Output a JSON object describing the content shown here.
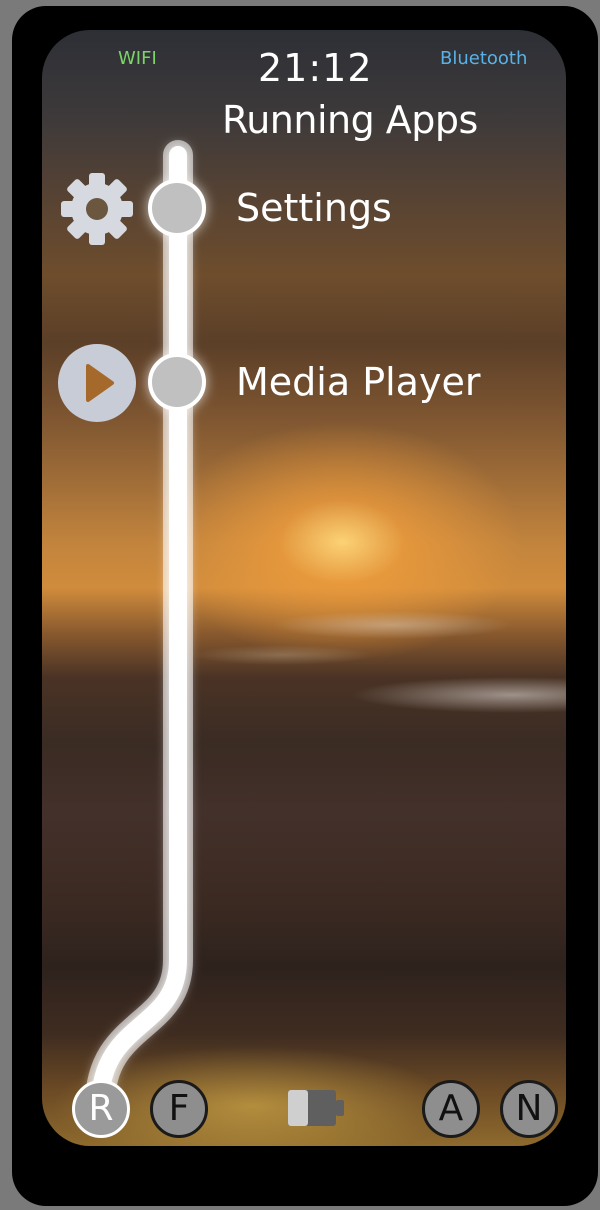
{
  "status_bar": {
    "wifi_label": "WIFI",
    "bluetooth_label": "Bluetooth",
    "time": "21:12",
    "wifi_color": "#7bd468",
    "bluetooth_color": "#58b2e8"
  },
  "heading": "Running Apps",
  "apps": [
    {
      "label": "Settings",
      "icon": "gear-icon"
    },
    {
      "label": "Media Player",
      "icon": "play-icon"
    }
  ],
  "bottom_bar": {
    "buttons": [
      {
        "label": "R",
        "selected": true
      },
      {
        "label": "F"
      },
      {
        "label": "A"
      },
      {
        "label": "N"
      }
    ],
    "battery_icon": "battery-icon"
  }
}
